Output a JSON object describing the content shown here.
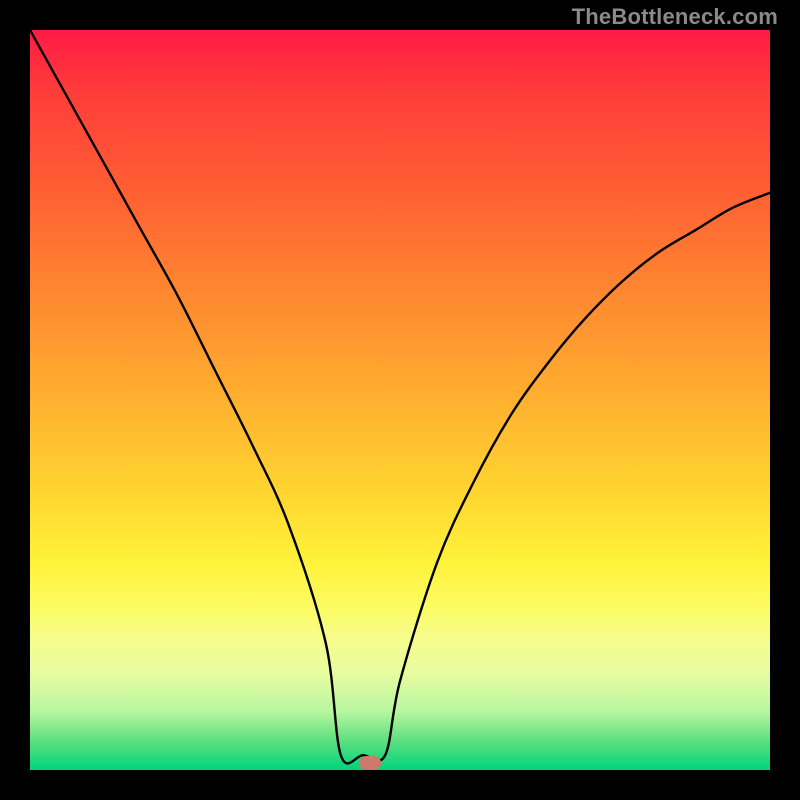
{
  "watermark": "TheBottleneck.com",
  "chart_data": {
    "type": "line",
    "title": "",
    "xlabel": "",
    "ylabel": "",
    "xlim": [
      0,
      100
    ],
    "ylim": [
      0,
      100
    ],
    "background_gradient": [
      "#ff1a44",
      "#ff8630",
      "#fff23a",
      "#00d47b"
    ],
    "series": [
      {
        "name": "curve",
        "x": [
          0,
          5,
          10,
          15,
          20,
          25,
          30,
          35,
          40,
          42,
          45,
          48,
          50,
          55,
          60,
          65,
          70,
          75,
          80,
          85,
          90,
          95,
          100
        ],
        "y": [
          100,
          91,
          82,
          73,
          64,
          54,
          44,
          33,
          17,
          2,
          2,
          2,
          12,
          28,
          39,
          48,
          55,
          61,
          66,
          70,
          73,
          76,
          78
        ]
      }
    ],
    "marker": {
      "x": 46,
      "y": 1,
      "color": "#cc7a6a"
    }
  }
}
